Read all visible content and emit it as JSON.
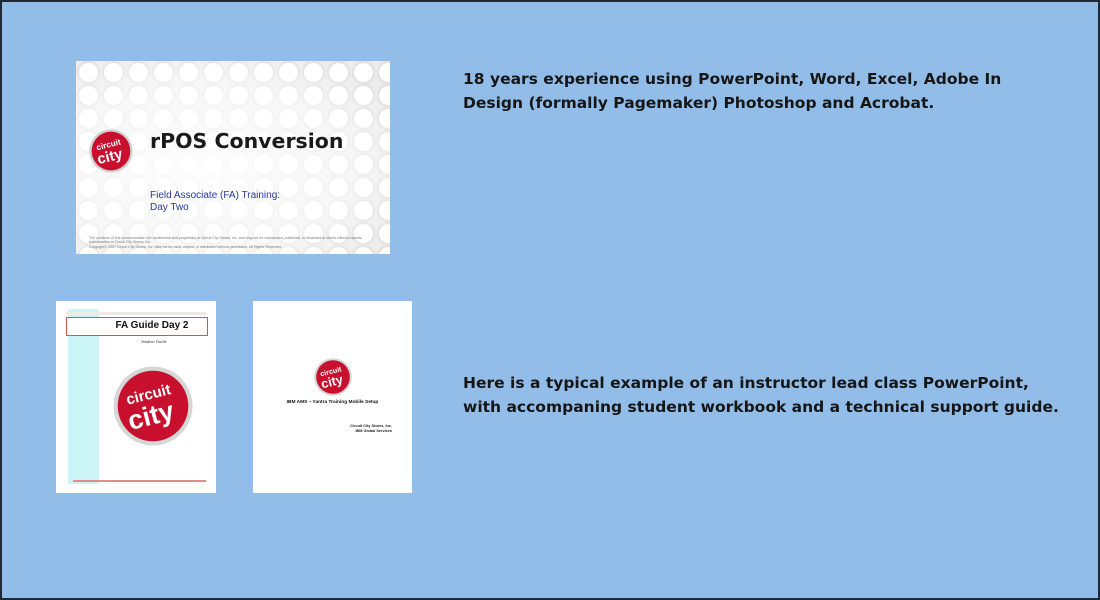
{
  "captions": {
    "skills": "18 years experience using PowerPoint, Word, Excel, Adobe In Design (formally Pagemaker) Photoshop and Acrobat.",
    "example": "Here is a typical example of an instructor lead class PowerPoint, with accompaning student workbook and a technical support guide."
  },
  "ppt_slide": {
    "title": "rPOS Conversion",
    "subtitle_line1": "Field Associate (FA) Training:",
    "subtitle_line2": "Day Two",
    "legal_line1": "The contents of this communication are confidential and proprietary to Circuit City Stores, Inc. and may not be reproduced, published, or disclosed to others without express authorization of Circuit City Stores, Inc.",
    "legal_line2": "Copyright© 2007 Circuit City Stores, Inc. May not be used, copied, or distributed without permission. All Rights Reserved."
  },
  "workbook": {
    "title": "FA Guide Day 2",
    "subtitle": "Student Guide"
  },
  "tech_guide": {
    "title": "IBM AMS – Yantra Training Mobile Setup",
    "company_line1": "Circuit City Stores, Inc.",
    "company_line2": "IBM Global Services"
  },
  "logo": {
    "text_top": "circuit",
    "text_bottom": "city",
    "brand_red": "#c8102e"
  },
  "colors": {
    "background": "#93bde9",
    "border": "#1e2a36"
  }
}
